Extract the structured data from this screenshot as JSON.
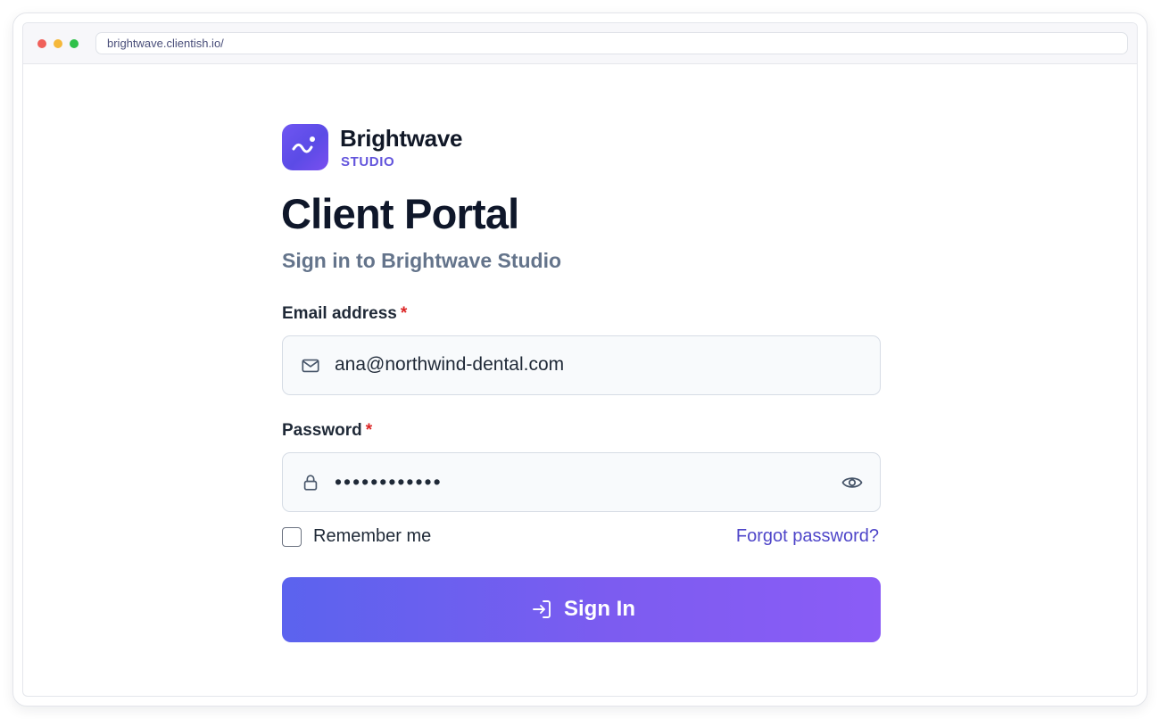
{
  "browser": {
    "url": "brightwave.clientish.io/"
  },
  "brand": {
    "name": "Brightwave",
    "tagline": "STUDIO",
    "logo_icon": "wave-icon",
    "accent_color": "#6355dc"
  },
  "page": {
    "title": "Client Portal",
    "subtitle": "Sign in to Brightwave Studio"
  },
  "form": {
    "email": {
      "label": "Email address",
      "required_marker": "*",
      "value": "ana@northwind-dental.com",
      "icon": "mail-icon"
    },
    "password": {
      "label": "Password",
      "required_marker": "*",
      "value": "••••••••••••",
      "icon": "lock-icon",
      "toggle_icon": "eye-icon"
    },
    "remember": {
      "label": "Remember me",
      "checked": false
    },
    "forgot_link": "Forgot password?",
    "submit": {
      "label": "Sign In",
      "icon": "sign-in-icon",
      "gradient": [
        "#5b63ee",
        "#8b5cf6"
      ]
    }
  }
}
